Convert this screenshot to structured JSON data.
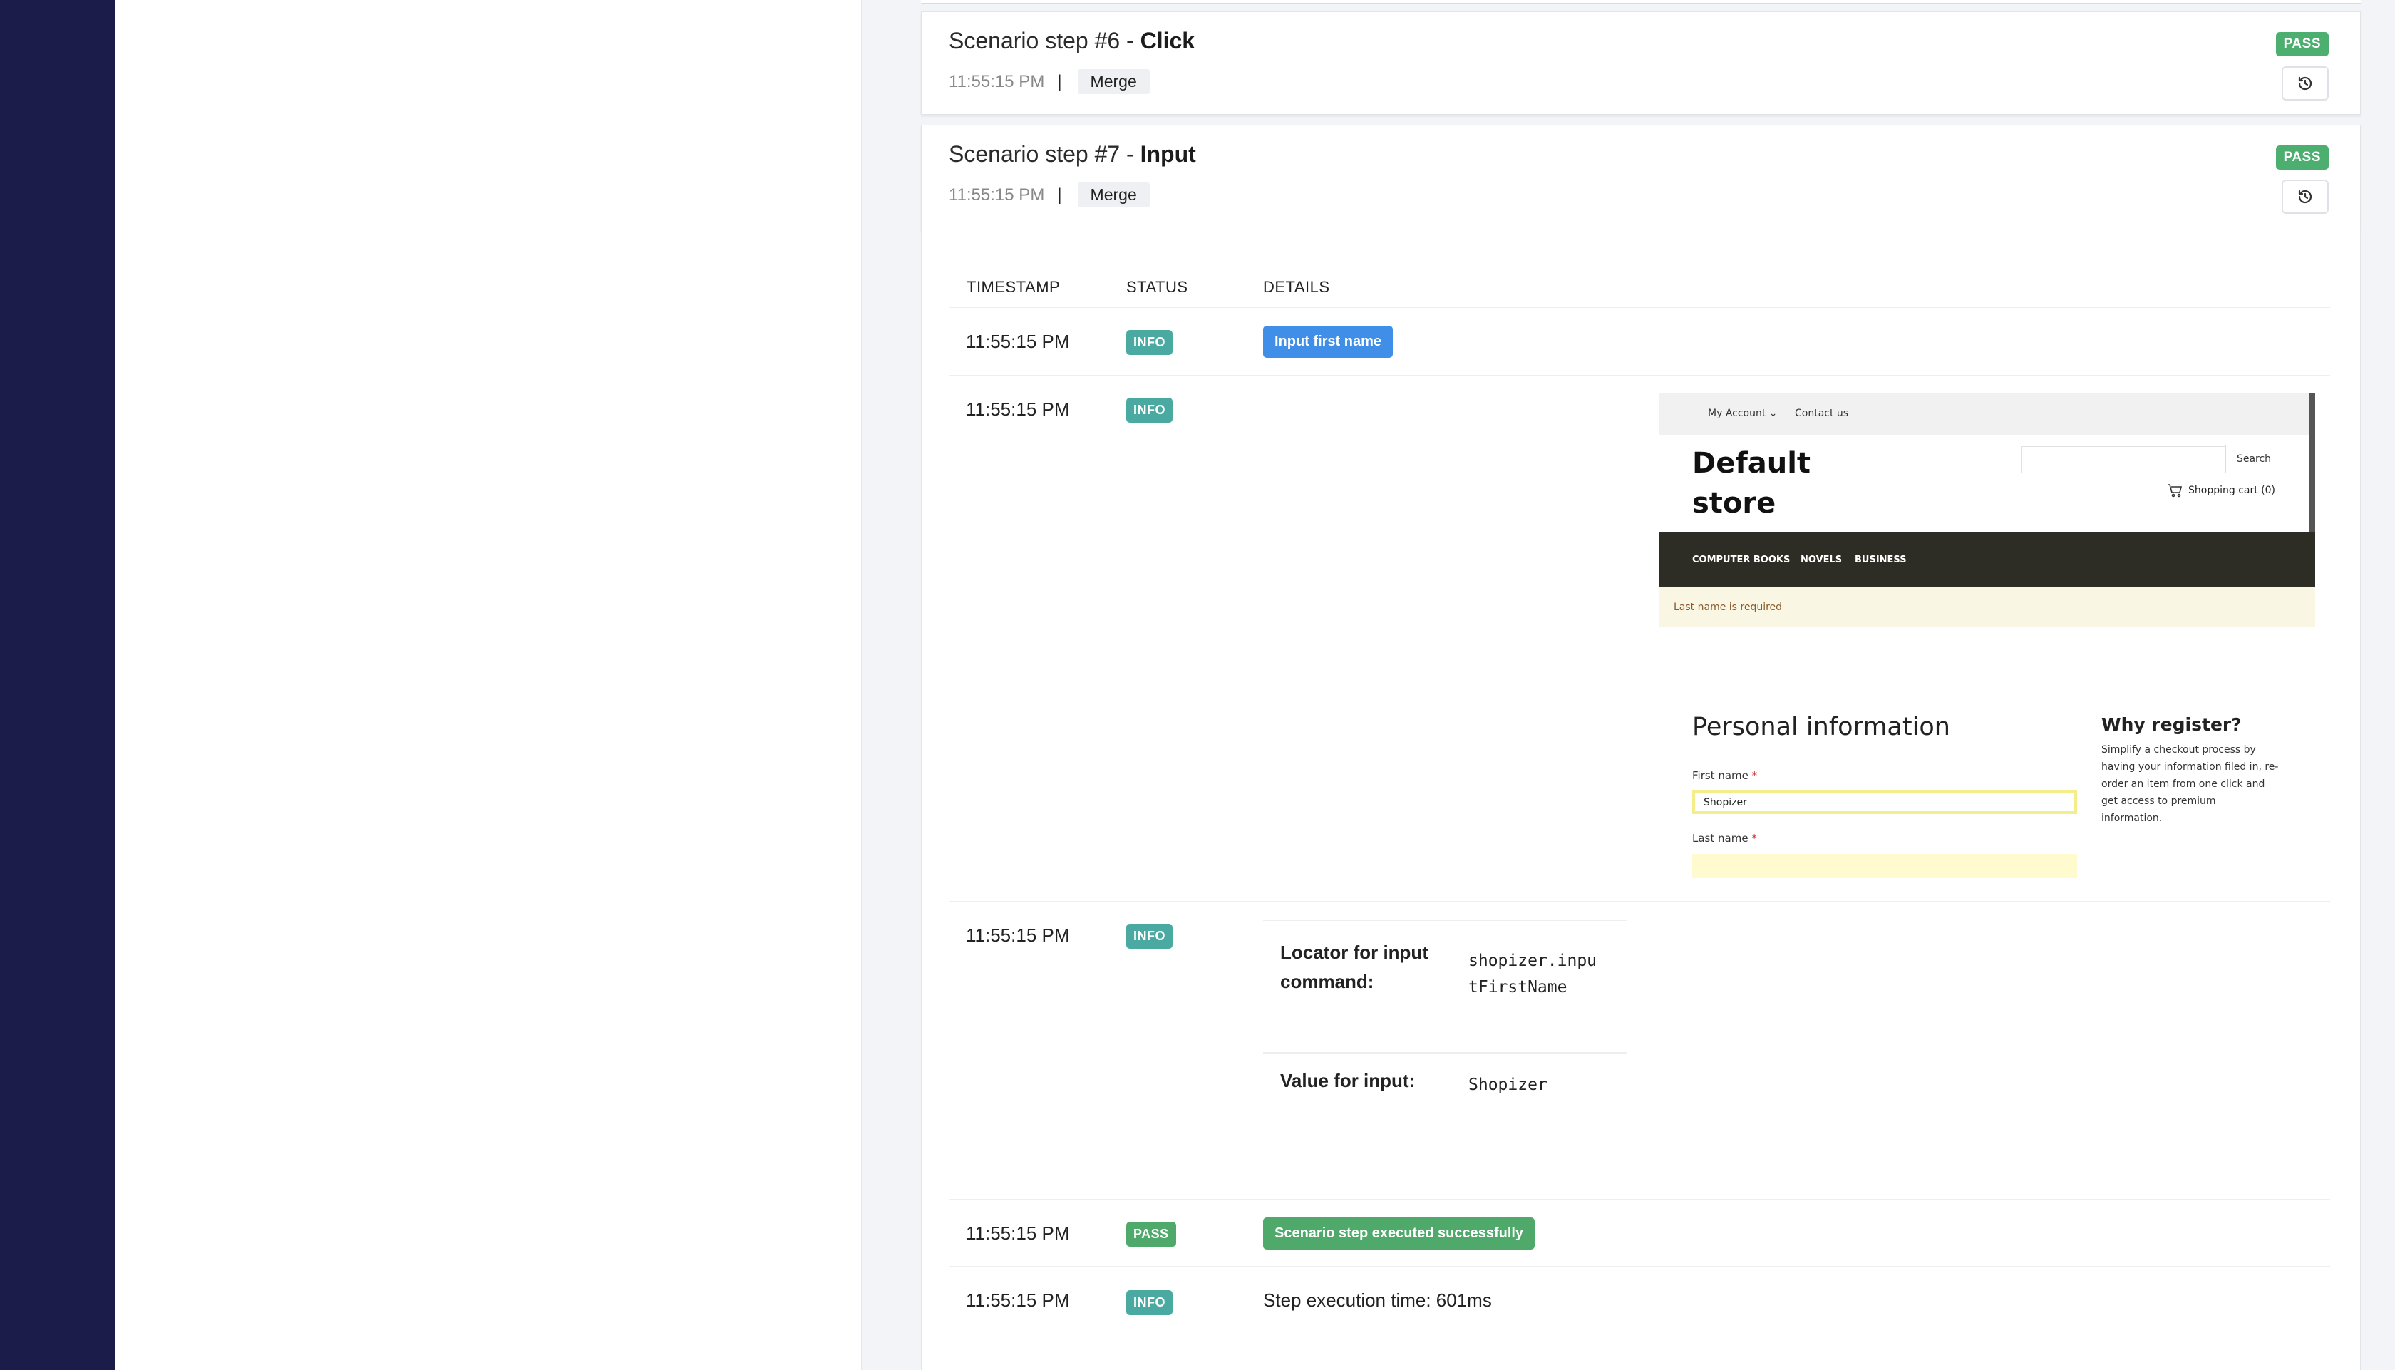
{
  "steps": [
    {
      "title_prefix": "Scenario step #6 - ",
      "title_action": "Click",
      "time": "11:55:15 PM",
      "separator": "|",
      "tag": "Merge",
      "status": "PASS"
    },
    {
      "title_prefix": "Scenario step #7 - ",
      "title_action": "Input",
      "time": "11:55:15 PM",
      "separator": "|",
      "tag": "Merge",
      "status": "PASS"
    }
  ],
  "icons": {
    "history": "history-icon",
    "cart": "cart-icon",
    "chevron": "chevron-down-icon"
  },
  "colors": {
    "sidebar": "#1b1c4a",
    "pass": "#4caf70",
    "info": "#4aa9a1",
    "detail_blue": "#3f8ee8"
  },
  "log_table": {
    "headers": [
      "TIMESTAMP",
      "STATUS",
      "DETAILS"
    ],
    "rows": [
      {
        "timestamp": "11:55:15 PM",
        "status": "INFO",
        "detail": "Input first name"
      },
      {
        "timestamp": "11:55:15 PM",
        "status": "INFO"
      },
      {
        "timestamp": "11:55:15 PM",
        "status": "INFO",
        "locator_label": "Locator for input command:",
        "locator_value": "shopizer.inputFirstName",
        "value_label": "Value for input:",
        "value_value": "Shopizer"
      },
      {
        "timestamp": "11:55:15 PM",
        "status": "PASS",
        "detail": "Scenario step executed successfully"
      },
      {
        "timestamp": "11:55:15 PM",
        "status": "INFO",
        "detail": "Step execution time: 601ms"
      }
    ]
  },
  "screenshot": {
    "top_links": [
      "My Account",
      "Contact us"
    ],
    "store_title_line1": "Default",
    "store_title_line2": "store",
    "search_button": "Search",
    "cart": "Shopping cart (0)",
    "nav": [
      "COMPUTER BOOKS",
      "NOVELS",
      "BUSINESS"
    ],
    "alert": "Last name is required",
    "section_title": "Personal information",
    "first_name_label": "First name",
    "first_name_value": "Shopizer",
    "last_name_label": "Last name",
    "required_mark": "*",
    "why_title": "Why register?",
    "why_text": "Simplify a checkout process by having your information filed in, re-order an item from one click and get access to premium information."
  }
}
